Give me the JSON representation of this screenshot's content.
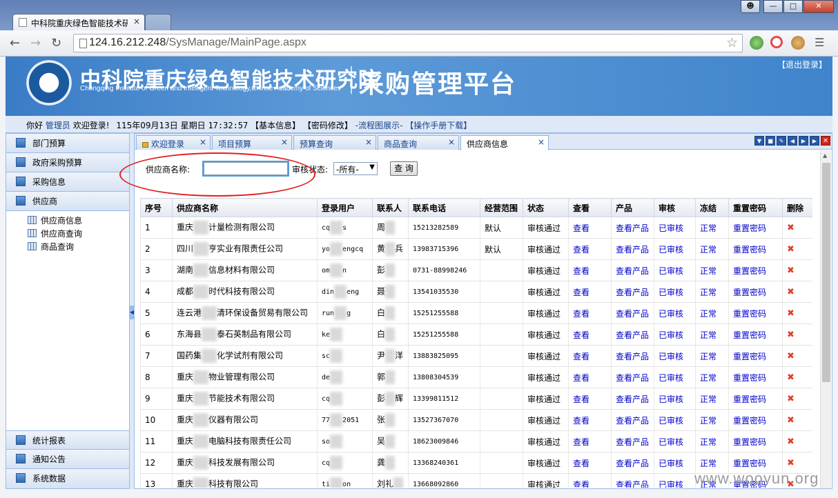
{
  "browser": {
    "tab_title": "中科院重庆绿色智能技术研",
    "url_host": "124.16.212.248",
    "url_path": "/SysManage/MainPage.aspx"
  },
  "banner": {
    "org_cn": "中科院重庆绿色智能技术研究院",
    "org_en": "Chongqing Institute of Green and Intelligent Technology,Chinse Academy of Sciences",
    "platform": "采购管理平台",
    "logout": "【退出登录】"
  },
  "infobar": {
    "hello": "你好",
    "user": "管理员",
    "welcome": "欢迎登录!",
    "date": "115年09月13日",
    "weekday": "星期日",
    "time": "17:32:57",
    "basic": "【基本信息】",
    "pwd": "【密码修改】",
    "flow": "-流程图展示-",
    "manual": "【操作手册下载】"
  },
  "sidebar": {
    "items": [
      "部门预算",
      "政府采购预算",
      "采购信息",
      "供应商"
    ],
    "sub": [
      "供应商信息",
      "供应商查询",
      "商品查询"
    ],
    "bottom": [
      "统计报表",
      "通知公告",
      "系统数据"
    ]
  },
  "tabs": [
    "欢迎登录",
    "项目预算",
    "预算查询",
    "商品查询",
    "供应商信息"
  ],
  "search": {
    "name_label": "供应商名称:",
    "status_label": "审核状态:",
    "status_value": "-所有-",
    "button": "查 询"
  },
  "columns": [
    "序号",
    "供应商名称",
    "登录用户",
    "联系人",
    "联系电话",
    "经营范围",
    "状态",
    "查看",
    "产品",
    "审核",
    "冻结",
    "重置密码",
    "删除"
  ],
  "rows": [
    {
      "no": "1",
      "name_a": "重庆",
      "name_b": "计量检测有限公司",
      "user_a": "cq",
      "user_b": "s",
      "contact_a": "周",
      "contact_b": "",
      "phone": "15213282589",
      "scope": "默认"
    },
    {
      "no": "2",
      "name_a": "四川",
      "name_b": "亨实业有限责任公司",
      "user_a": "yo",
      "user_b": "engcq",
      "contact_a": "黄",
      "contact_b": "兵",
      "phone": "13983715396",
      "scope": "默认"
    },
    {
      "no": "3",
      "name_a": "湖南",
      "name_b": "信息材料有限公司",
      "user_a": "om",
      "user_b": "n",
      "contact_a": "彭",
      "contact_b": "",
      "phone": "0731-88998246",
      "scope": ""
    },
    {
      "no": "4",
      "name_a": "成都",
      "name_b": "时代科技有限公司",
      "user_a": "din",
      "user_b": "eng",
      "contact_a": "聂",
      "contact_b": "",
      "phone": "13541035530",
      "scope": ""
    },
    {
      "no": "5",
      "name_a": "连云港",
      "name_b": "清环保设备贸易有限公司",
      "user_a": "run",
      "user_b": "g",
      "contact_a": "白",
      "contact_b": "",
      "phone": "15251255588",
      "scope": ""
    },
    {
      "no": "6",
      "name_a": "东海县",
      "name_b": "泰石英制品有限公司",
      "user_a": "ke",
      "user_b": "",
      "contact_a": "白",
      "contact_b": "",
      "phone": "15251255588",
      "scope": ""
    },
    {
      "no": "7",
      "name_a": "国药集",
      "name_b": "化学试剂有限公司",
      "user_a": "sc",
      "user_b": "",
      "contact_a": "尹",
      "contact_b": "洋",
      "phone": "13883825095",
      "scope": ""
    },
    {
      "no": "8",
      "name_a": "重庆",
      "name_b": "物业管理有限公司",
      "user_a": "de",
      "user_b": "",
      "contact_a": "郭",
      "contact_b": "",
      "phone": "13808304539",
      "scope": ""
    },
    {
      "no": "9",
      "name_a": "重庆",
      "name_b": "节能技术有限公司",
      "user_a": "cq",
      "user_b": "",
      "contact_a": "彭",
      "contact_b": "辉",
      "phone": "13399811512",
      "scope": ""
    },
    {
      "no": "10",
      "name_a": "重庆",
      "name_b": "仪器有限公司",
      "user_a": "77",
      "user_b": "2051",
      "contact_a": "张",
      "contact_b": "",
      "phone": "13527367070",
      "scope": ""
    },
    {
      "no": "11",
      "name_a": "重庆",
      "name_b": "电脑科技有限责任公司",
      "user_a": "so",
      "user_b": "",
      "contact_a": "吴",
      "contact_b": "",
      "phone": "18623009846",
      "scope": ""
    },
    {
      "no": "12",
      "name_a": "重庆",
      "name_b": "科技发展有限公司",
      "user_a": "cq",
      "user_b": "",
      "contact_a": "龚",
      "contact_b": "",
      "phone": "13368240361",
      "scope": ""
    },
    {
      "no": "13",
      "name_a": "重庆",
      "name_b": "科技有限公司",
      "user_a": "ti",
      "user_b": "on",
      "contact_a": "刘礼",
      "contact_b": "",
      "phone": "13668092860",
      "scope": ""
    }
  ],
  "row_static": {
    "status": "审核通过",
    "view": "查看",
    "product": "查看产品",
    "audit": "已审核",
    "freeze": "正常",
    "reset": "重置密码",
    "delete": "✖"
  },
  "watermark": "www.wooyun.org",
  "colors": {
    "banner": "#3a7cc6",
    "link": "#0000cc",
    "highlight": "#e02020"
  }
}
